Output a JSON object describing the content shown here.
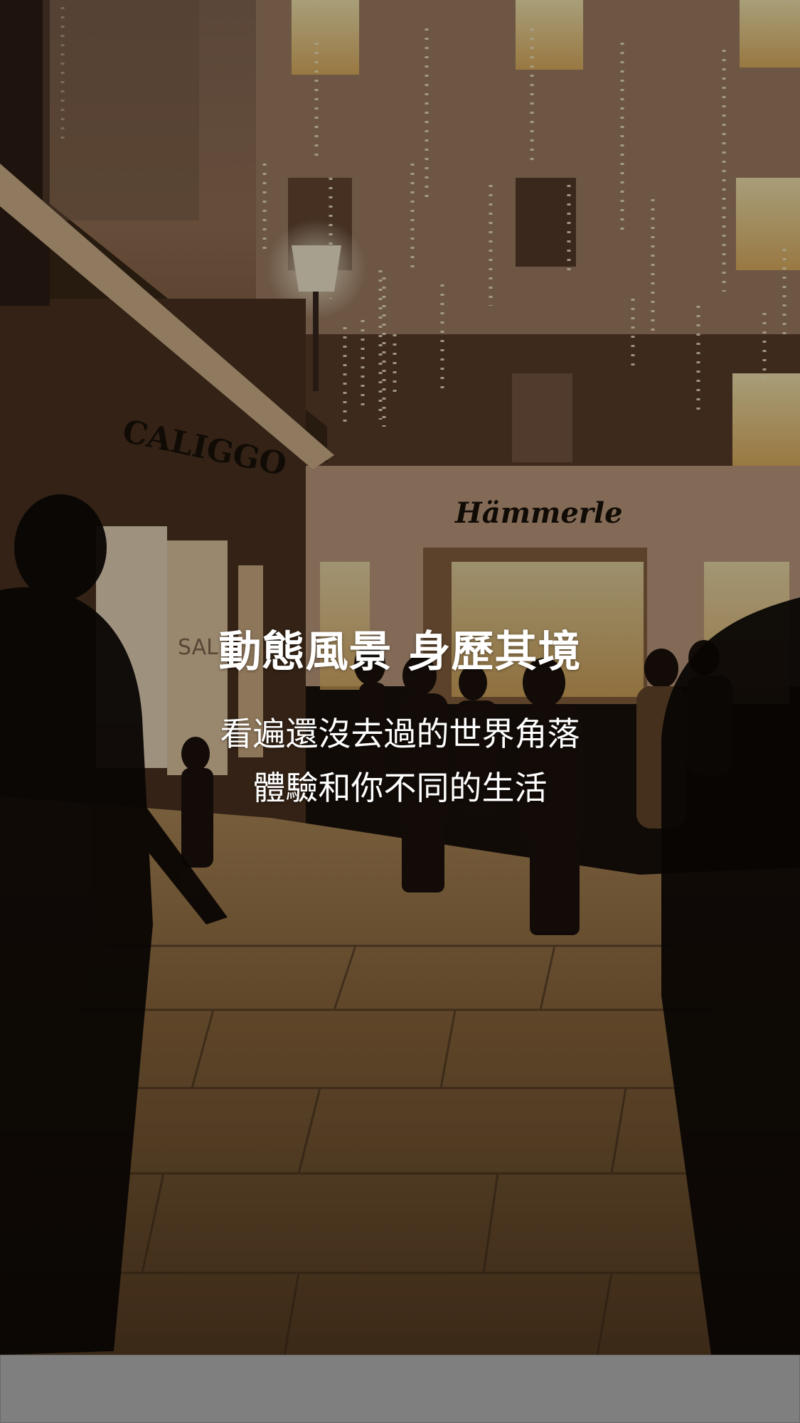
{
  "hero": {
    "headline": "動態風景 身歷其境",
    "subline_1": "看遍還沒去過的世界角落",
    "subline_2": "體驗和你不同的生活"
  },
  "photo": {
    "subject": "night-street-with-christmas-lights",
    "storefront_signs": [
      "CALIGGO",
      "Hämmerle",
      "SAL"
    ]
  },
  "colors": {
    "text": "#ffffff",
    "overlay": "rgba(0,0,0,0.34)",
    "bottom_bar": "#7f7f7f"
  }
}
